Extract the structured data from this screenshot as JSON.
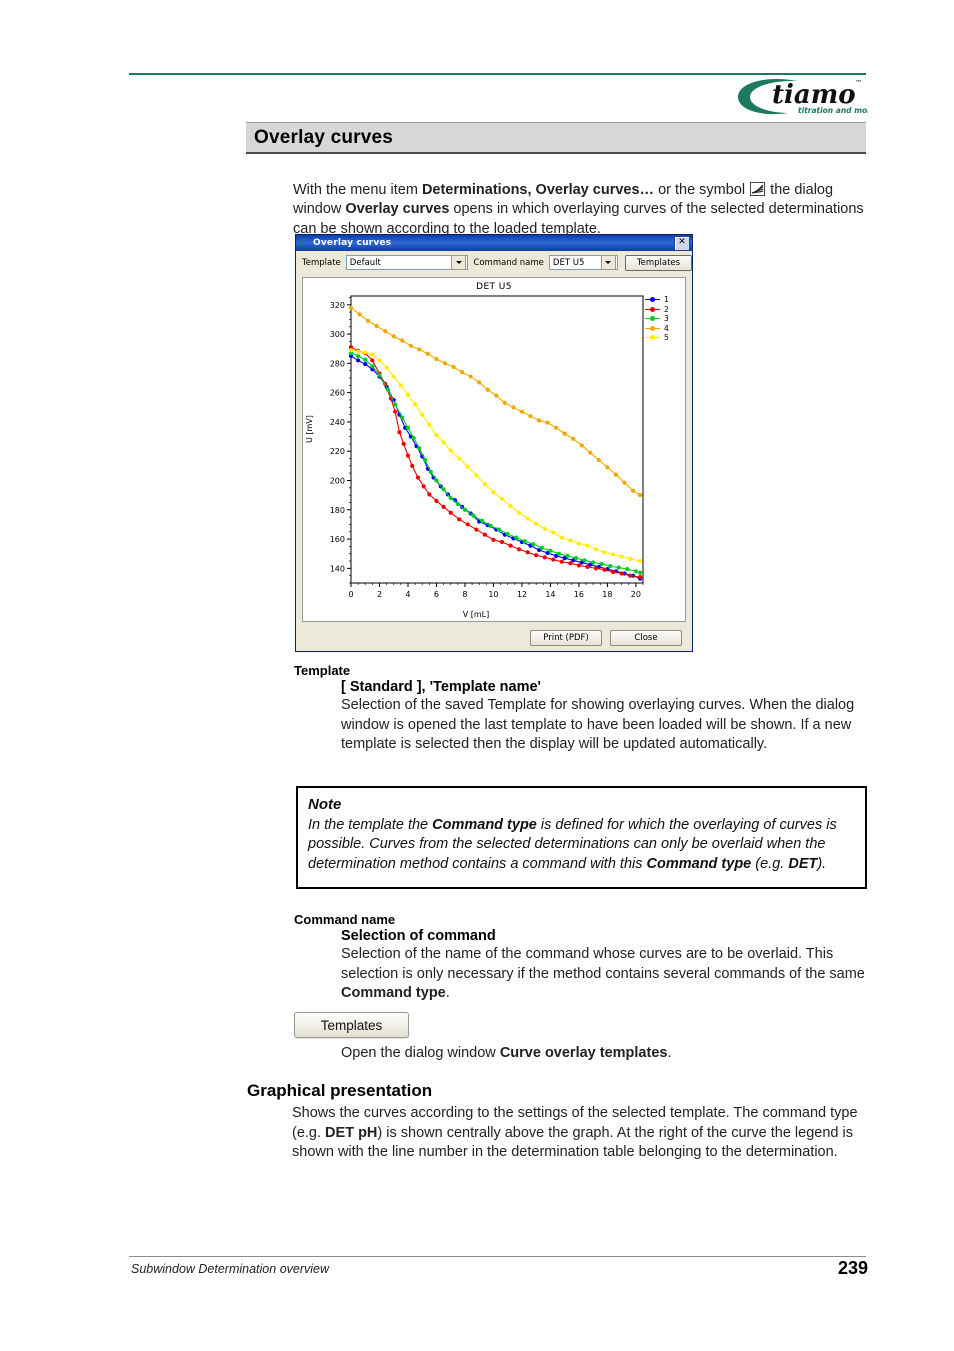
{
  "header": {
    "logo_word": "tiamo",
    "logo_tm": "TM",
    "logo_tagline": "titration and more"
  },
  "title": "Overlay curves",
  "intro": {
    "p1_a": "With the menu item ",
    "p1_menu": "Determinations, Overlay curves…",
    "p1_b": " or the symbol ",
    "p1_c": " the dialog window ",
    "p1_dialog": "Overlay curves",
    "p1_d": " opens in which overlaying curves of the selected determinations can be shown according to the loaded template."
  },
  "dialog": {
    "title": "Overlay curves",
    "close_label": "✕",
    "template_label": "Template",
    "template_value": "Default",
    "command_label": "Command name",
    "command_value": "DET U5",
    "templates_button": "Templates",
    "print_button": "Print (PDF)",
    "close_button": "Close"
  },
  "chart_data": {
    "type": "line",
    "title": "DET U5",
    "xlabel": "V [mL]",
    "ylabel": "U [mV]",
    "xlim": [
      0,
      20.5
    ],
    "ylim": [
      130,
      326
    ],
    "xticks": [
      0,
      2,
      4,
      6,
      8,
      10,
      12,
      14,
      16,
      18,
      20
    ],
    "yticks": [
      140,
      160,
      180,
      200,
      220,
      240,
      260,
      280,
      300,
      320
    ],
    "grid": false,
    "legend_position": "right",
    "colors": {
      "1": "#0000ff",
      "2": "#ee0000",
      "3": "#00cc22",
      "4": "#f0a800",
      "5": "#ffee00"
    },
    "series": [
      {
        "name": "1",
        "color": "#0000ff",
        "x": [
          0.0,
          0.5,
          1.0,
          1.5,
          2.0,
          2.5,
          3.0,
          3.4,
          3.8,
          4.2,
          4.6,
          5.0,
          5.4,
          5.8,
          6.3,
          6.8,
          7.3,
          7.8,
          8.4,
          9.0,
          9.6,
          10.2,
          10.8,
          11.4,
          12.0,
          12.6,
          13.2,
          13.8,
          14.4,
          15.0,
          15.6,
          16.2,
          16.8,
          17.4,
          18.0,
          18.6,
          19.2,
          19.8,
          20.3
        ],
        "y": [
          285.0,
          282.0,
          279.5,
          276.0,
          271.0,
          264.0,
          255.0,
          245.0,
          236.0,
          230.0,
          223.5,
          216.5,
          208.0,
          202.0,
          196.0,
          190.5,
          186.5,
          182.0,
          177.5,
          172.0,
          169.5,
          166.5,
          163.0,
          160.5,
          158.0,
          155.5,
          152.5,
          150.5,
          148.5,
          147.0,
          145.5,
          144.0,
          142.5,
          141.0,
          139.5,
          138.0,
          136.5,
          135.0,
          133.0
        ]
      },
      {
        "name": "2",
        "color": "#ee0000",
        "x": [
          0.0,
          0.5,
          1.0,
          1.5,
          2.0,
          2.4,
          2.8,
          3.1,
          3.4,
          3.7,
          4.0,
          4.3,
          4.7,
          5.1,
          5.5,
          6.0,
          6.5,
          7.0,
          7.6,
          8.2,
          8.8,
          9.4,
          10.0,
          10.6,
          11.2,
          11.8,
          12.4,
          13.0,
          13.6,
          14.2,
          14.8,
          15.4,
          16.0,
          16.6,
          17.2,
          17.8,
          18.4,
          19.0,
          19.6,
          20.3
        ],
        "y": [
          291.0,
          288.5,
          287.0,
          282.0,
          273.0,
          266.0,
          256.0,
          247.0,
          233.0,
          225.0,
          217.0,
          210.0,
          202.0,
          196.0,
          190.5,
          186.0,
          182.0,
          178.0,
          173.5,
          170.0,
          166.5,
          163.0,
          159.5,
          158.0,
          155.5,
          153.0,
          151.0,
          149.0,
          147.5,
          146.0,
          144.5,
          143.5,
          142.0,
          141.0,
          140.0,
          139.0,
          137.5,
          136.5,
          135.0,
          134.0
        ]
      },
      {
        "name": "3",
        "color": "#00cc22",
        "x": [
          0.0,
          0.5,
          1.0,
          1.5,
          2.0,
          2.6,
          3.1,
          3.6,
          4.0,
          4.4,
          4.8,
          5.2,
          5.6,
          6.0,
          6.5,
          7.0,
          7.5,
          8.0,
          8.6,
          9.2,
          9.8,
          10.4,
          11.0,
          11.6,
          12.2,
          12.8,
          13.4,
          14.0,
          14.6,
          15.2,
          15.8,
          16.4,
          17.0,
          17.6,
          18.2,
          18.8,
          19.4,
          20.0,
          20.3
        ],
        "y": [
          287.0,
          285.0,
          282.5,
          278.0,
          272.0,
          262.0,
          252.0,
          243.0,
          236.0,
          229.0,
          222.0,
          214.0,
          206.0,
          200.0,
          194.0,
          188.0,
          184.0,
          180.0,
          176.0,
          172.5,
          169.0,
          166.5,
          163.5,
          161.0,
          158.5,
          156.5,
          154.0,
          152.0,
          150.0,
          148.5,
          147.0,
          145.5,
          144.0,
          143.0,
          141.5,
          140.5,
          139.5,
          138.0,
          137.0
        ]
      },
      {
        "name": "4",
        "color": "#f0a800",
        "x": [
          0.0,
          0.6,
          1.2,
          1.8,
          2.4,
          3.0,
          3.6,
          4.2,
          4.8,
          5.4,
          6.0,
          6.6,
          7.2,
          7.8,
          8.4,
          9.0,
          9.6,
          10.2,
          10.8,
          11.4,
          12.0,
          12.6,
          13.2,
          13.8,
          14.4,
          15.0,
          15.6,
          16.2,
          16.8,
          17.4,
          18.0,
          18.6,
          19.2,
          19.8,
          20.3
        ],
        "y": [
          318.0,
          313.5,
          309.0,
          305.5,
          302.0,
          298.5,
          295.5,
          292.0,
          289.5,
          286.5,
          283.0,
          280.0,
          277.5,
          274.0,
          271.0,
          267.0,
          262.0,
          258.0,
          253.0,
          250.0,
          247.0,
          244.0,
          241.0,
          239.5,
          236.0,
          232.0,
          228.5,
          224.0,
          219.0,
          214.0,
          209.0,
          204.0,
          198.5,
          193.0,
          190.0
        ]
      },
      {
        "name": "5",
        "color": "#ffee00",
        "x": [
          0.0,
          0.5,
          1.0,
          1.5,
          2.0,
          2.5,
          3.0,
          3.5,
          4.0,
          4.5,
          5.0,
          5.5,
          6.0,
          6.5,
          7.0,
          7.6,
          8.2,
          8.8,
          9.4,
          10.0,
          10.6,
          11.2,
          11.8,
          12.4,
          13.0,
          13.6,
          14.2,
          14.8,
          15.4,
          16.0,
          16.6,
          17.2,
          17.8,
          18.4,
          19.0,
          19.6,
          20.3
        ],
        "y": [
          289.0,
          288.0,
          287.5,
          286.0,
          282.0,
          277.0,
          271.0,
          265.0,
          258.5,
          252.0,
          245.0,
          238.0,
          231.0,
          226.0,
          220.5,
          215.0,
          209.5,
          203.5,
          197.5,
          192.0,
          187.5,
          182.5,
          178.0,
          174.0,
          170.5,
          167.0,
          164.5,
          161.0,
          159.0,
          157.0,
          155.5,
          153.0,
          151.0,
          149.5,
          148.0,
          146.5,
          145.0
        ]
      }
    ]
  },
  "sections": {
    "template": {
      "head": "Template",
      "sub": "[ Standard ], 'Template name'",
      "body": "Selection of the saved Template for showing overlaying curves. When the dialog window is opened the last template to have been loaded will be shown. If a new template is selected then the display will be updated automatically."
    },
    "note": {
      "head": "Note",
      "t1": "In the template the ",
      "b1": "Command type",
      "t2": " is defined for which the overlaying of curves is possible. Curves from the selected determinations can only be overlaid when the determination method contains a command with this ",
      "b2": "Command type",
      "t3": " (e.g. ",
      "b3": "DET",
      "t4": ")."
    },
    "command_name": {
      "head": "Command name",
      "sub": "Selection of command",
      "t1": "Selection of the name of the command whose curves are to be overlaid. This selection is only necessary if the method contains several commands of the same ",
      "b1": "Command type",
      "t2": "."
    },
    "templates_button": {
      "label": "Templates",
      "t1": "Open the dialog window ",
      "b1": "Curve overlay templates",
      "t2": "."
    },
    "graphical": {
      "head": "Graphical presentation",
      "t1": "Shows the curves according to the settings of the selected template. The command type (e.g. ",
      "b1": "DET pH",
      "t2": ") is shown centrally above the graph. At the right of the curve the legend is shown with the line number in the determination table belonging to the determination."
    }
  },
  "footer": {
    "left": "Subwindow Determination overview",
    "page": "239"
  }
}
